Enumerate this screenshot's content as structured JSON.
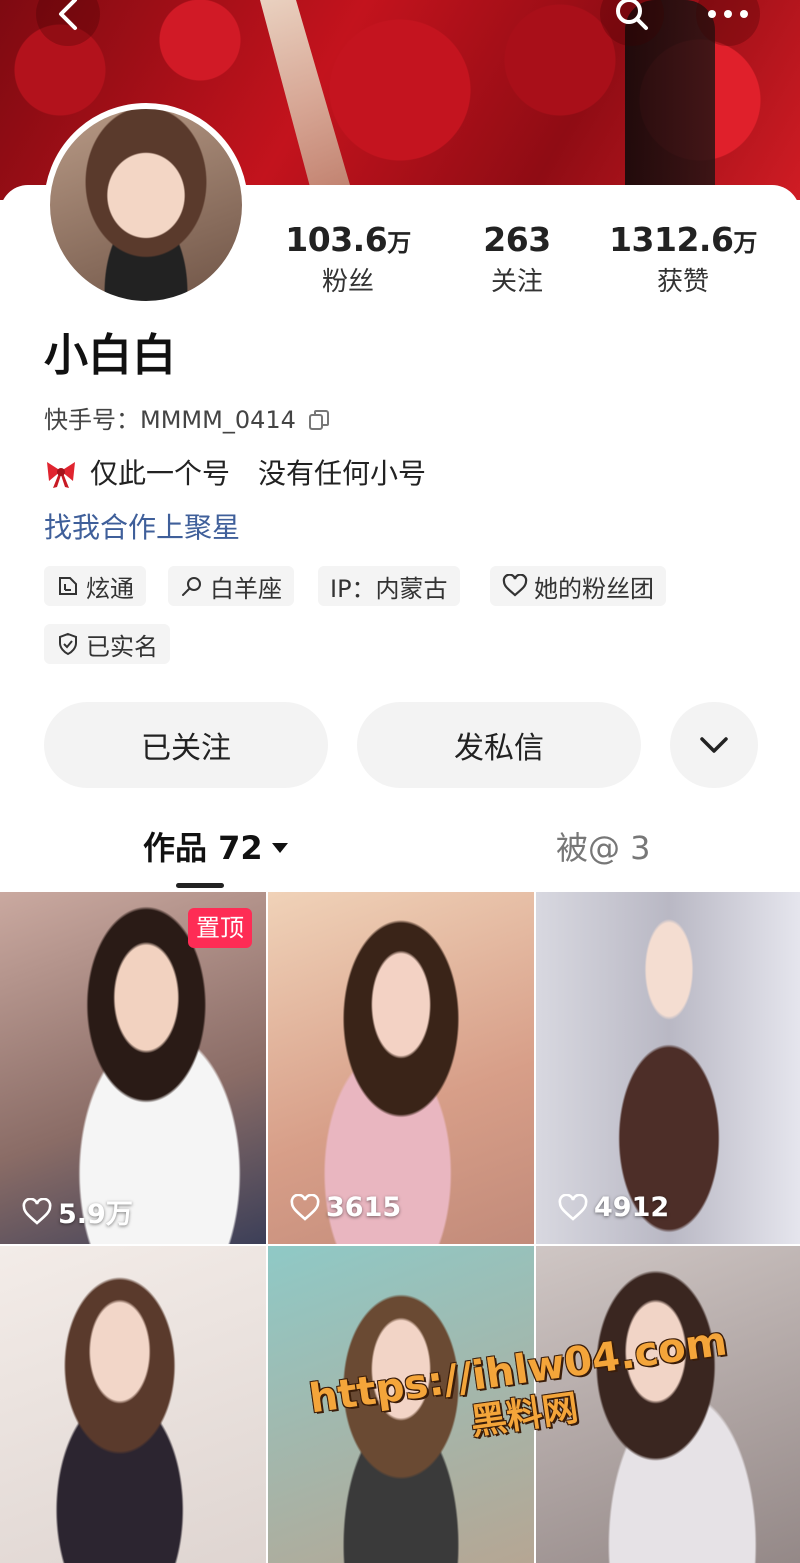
{
  "profile": {
    "name": "小白白",
    "kuaishou_id_label": "快手号：MMMM_0414",
    "bio": [
      "仅此一个号",
      "没有任何小号"
    ],
    "cooperation_link": "找我合作上聚星"
  },
  "stats": {
    "fans": {
      "value": "103.6",
      "unit": "万",
      "label": "粉丝"
    },
    "following": {
      "value": "263",
      "unit": "",
      "label": "关注"
    },
    "likes": {
      "value": "1312.6",
      "unit": "万",
      "label": "获赞"
    }
  },
  "tags": {
    "xuantong": "炫通",
    "zodiac": "白羊座",
    "ip": "IP：内蒙古",
    "fan_club": "她的粉丝团",
    "real_name": "已实名"
  },
  "actions": {
    "followed": "已关注",
    "message": "发私信"
  },
  "tabs": {
    "works": "作品 72",
    "mentions": "被@ 3"
  },
  "grid": {
    "pinned_badge": "置顶",
    "items": [
      {
        "likes": "5.9万"
      },
      {
        "likes": "3615"
      },
      {
        "likes": "4912"
      },
      {
        "likes": ""
      },
      {
        "likes": ""
      },
      {
        "likes": ""
      }
    ]
  },
  "watermark": {
    "url": "https://ihlw04.com",
    "site": "黑料网"
  },
  "icons": [
    "back-icon",
    "search-icon",
    "more-icon",
    "copy-icon",
    "bow-icon",
    "xuantong-icon",
    "zodiac-icon",
    "heart-outline-icon",
    "shield-icon",
    "chevron-down-icon",
    "caret-down-icon",
    "like-icon"
  ],
  "colors": {
    "link": "#3f5f9a",
    "pin_badge": "#fe2c55",
    "button_bg": "#f3f3f3"
  }
}
